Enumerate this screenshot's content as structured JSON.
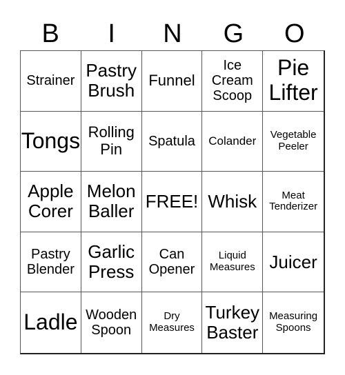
{
  "header": [
    "B",
    "I",
    "N",
    "G",
    "O"
  ],
  "cells": [
    [
      "Strainer",
      "Pastry Brush",
      "Funnel",
      "Ice Cream Scoop",
      "Pie Lifter"
    ],
    [
      "Tongs",
      "Rolling Pin",
      "Spatula",
      "Colander",
      "Vegetable Peeler"
    ],
    [
      "Apple Corer",
      "Melon Baller",
      "FREE!",
      "Whisk",
      "Meat Tenderizer"
    ],
    [
      "Pastry Blender",
      "Garlic Press",
      "Can Opener",
      "Liquid Measures",
      "Juicer"
    ],
    [
      "Ladle",
      "Wooden Spoon",
      "Dry Measures",
      "Turkey Baster",
      "Measuring Spoons"
    ]
  ]
}
